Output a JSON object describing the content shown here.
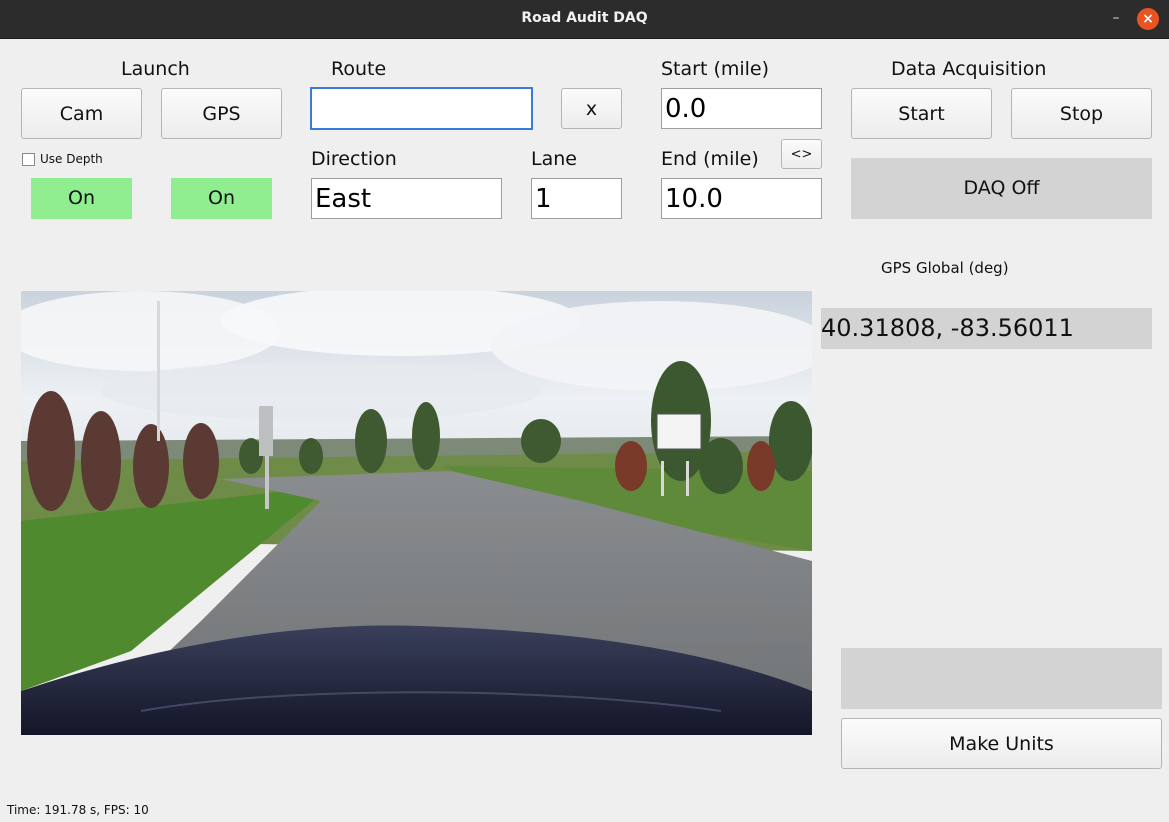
{
  "window": {
    "title": "Road Audit DAQ"
  },
  "launch": {
    "label": "Launch",
    "cam_button": "Cam",
    "gps_button": "GPS",
    "use_depth_label": "Use Depth",
    "cam_status": "On",
    "gps_status": "On"
  },
  "route": {
    "label": "Route",
    "value": "",
    "clear_button": "x"
  },
  "direction": {
    "label": "Direction",
    "value": "East"
  },
  "lane": {
    "label": "Lane",
    "value": "1"
  },
  "start_mile": {
    "label": "Start (mile)",
    "value": "0.0"
  },
  "end_mile": {
    "label": "End (mile)",
    "value": "10.0"
  },
  "swap_button": "<>",
  "daq": {
    "label": "Data Acquisition",
    "start_button": "Start",
    "stop_button": "Stop",
    "status": "DAQ Off"
  },
  "gps": {
    "label": "GPS Global (deg)",
    "value": "40.31808, -83.56011"
  },
  "units": {
    "display": "",
    "make_button": "Make Units"
  },
  "status_bar": {
    "text": "Time: 191.78 s, FPS: 10"
  },
  "colors": {
    "status_on": "#90ee90",
    "panel_grey": "#d3d3d3",
    "close_button": "#e95420"
  }
}
